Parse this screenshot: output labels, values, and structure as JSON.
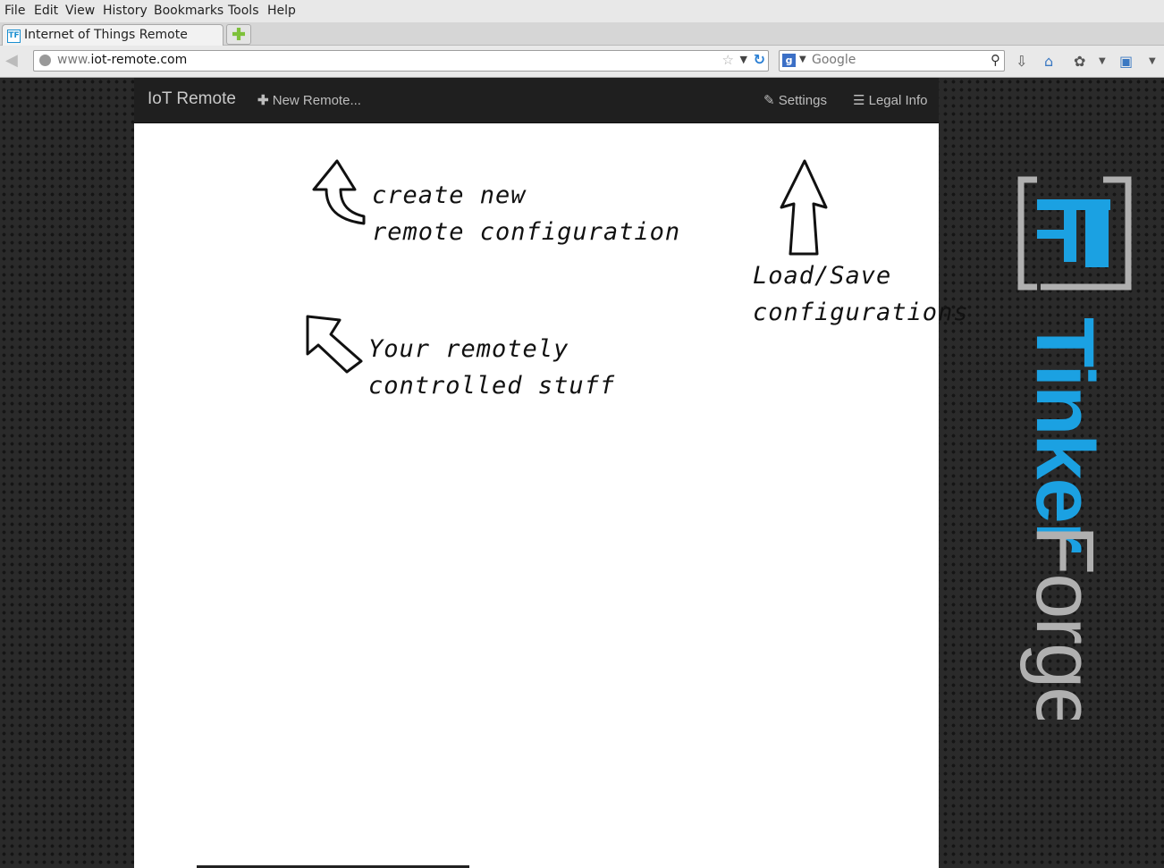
{
  "menubar": {
    "items": [
      "File",
      "Edit",
      "View",
      "History",
      "Bookmarks",
      "Tools",
      "Help"
    ]
  },
  "tab": {
    "favicon": "TF",
    "title": "Internet of Things Remote"
  },
  "toolbar": {
    "url_prefix": "www.",
    "url_host": "iot-remote.com",
    "search_placeholder": "Google",
    "search_engine_icon": "g"
  },
  "app": {
    "brand": "IoT Remote",
    "new_remote": "New Remote...",
    "settings": "Settings",
    "legal_info": "Legal Info"
  },
  "hints": {
    "create_line1": "create new",
    "create_line2": "remote configuration",
    "load_line1": "Load/Save",
    "load_line2": "configurations",
    "stuff_line1": "Your remotely",
    "stuff_line2": "controlled stuff"
  },
  "logo": {
    "mark": "TF",
    "word_blue": "Tinker",
    "word_grey": "Forge",
    "blue": "#1ba1e2",
    "grey": "#b0b0b0"
  }
}
